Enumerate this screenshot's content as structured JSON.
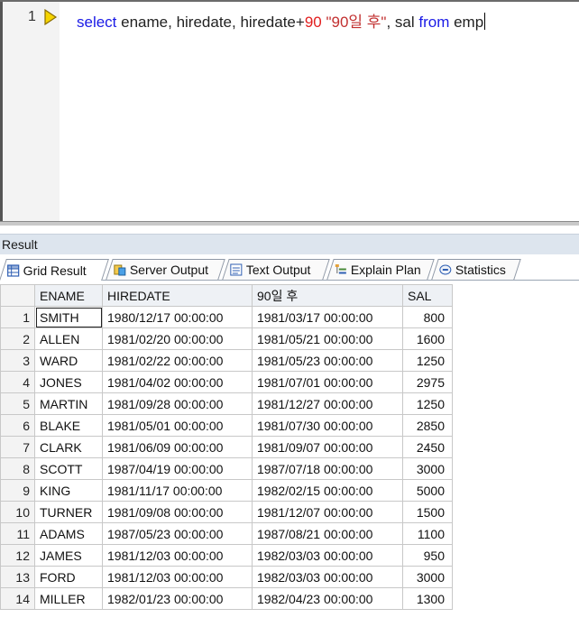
{
  "editor": {
    "line_number": "1",
    "code_tokens": [
      {
        "text": "select",
        "kind": "kw"
      },
      {
        "text": " ename, hiredate, hiredate+",
        "kind": "plain"
      },
      {
        "text": "90",
        "kind": "num"
      },
      {
        "text": " \"90일 후\"",
        "kind": "str"
      },
      {
        "text": ", sal ",
        "kind": "plain"
      },
      {
        "text": "from",
        "kind": "kw"
      },
      {
        "text": " emp",
        "kind": "plain"
      }
    ]
  },
  "result": {
    "title": "Result",
    "tabs": [
      {
        "label": "Grid Result",
        "icon": "grid-icon"
      },
      {
        "label": "Server Output",
        "icon": "server-output-icon"
      },
      {
        "label": "Text Output",
        "icon": "text-output-icon"
      },
      {
        "label": "Explain Plan",
        "icon": "explain-plan-icon"
      },
      {
        "label": "Statistics",
        "icon": "statistics-icon"
      }
    ],
    "active_tab": "Grid Result"
  },
  "grid": {
    "columns": [
      "ENAME",
      "HIREDATE",
      "90일 후",
      "SAL"
    ],
    "rows": [
      [
        "1",
        "SMITH",
        "1980/12/17 00:00:00",
        "1981/03/17 00:00:00",
        "800"
      ],
      [
        "2",
        "ALLEN",
        "1981/02/20 00:00:00",
        "1981/05/21 00:00:00",
        "1600"
      ],
      [
        "3",
        "WARD",
        "1981/02/22 00:00:00",
        "1981/05/23 00:00:00",
        "1250"
      ],
      [
        "4",
        "JONES",
        "1981/04/02 00:00:00",
        "1981/07/01 00:00:00",
        "2975"
      ],
      [
        "5",
        "MARTIN",
        "1981/09/28 00:00:00",
        "1981/12/27 00:00:00",
        "1250"
      ],
      [
        "6",
        "BLAKE",
        "1981/05/01 00:00:00",
        "1981/07/30 00:00:00",
        "2850"
      ],
      [
        "7",
        "CLARK",
        "1981/06/09 00:00:00",
        "1981/09/07 00:00:00",
        "2450"
      ],
      [
        "8",
        "SCOTT",
        "1987/04/19 00:00:00",
        "1987/07/18 00:00:00",
        "3000"
      ],
      [
        "9",
        "KING",
        "1981/11/17 00:00:00",
        "1982/02/15 00:00:00",
        "5000"
      ],
      [
        "10",
        "TURNER",
        "1981/09/08 00:00:00",
        "1981/12/07 00:00:00",
        "1500"
      ],
      [
        "11",
        "ADAMS",
        "1987/05/23 00:00:00",
        "1987/08/21 00:00:00",
        "1100"
      ],
      [
        "12",
        "JAMES",
        "1981/12/03 00:00:00",
        "1982/03/03 00:00:00",
        "950"
      ],
      [
        "13",
        "FORD",
        "1981/12/03 00:00:00",
        "1982/03/03 00:00:00",
        "3000"
      ],
      [
        "14",
        "MILLER",
        "1982/01/23 00:00:00",
        "1982/04/23 00:00:00",
        "1300"
      ]
    ]
  },
  "colors": {
    "keyword": "#1a1ae6",
    "number": "#e21e1e",
    "string": "#c23030",
    "result_header_bg": "#dde5ee"
  }
}
